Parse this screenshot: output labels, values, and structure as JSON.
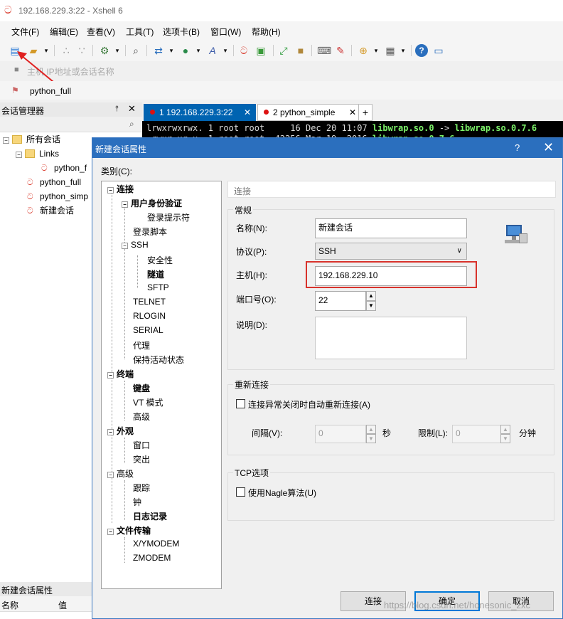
{
  "window": {
    "title": "192.168.229.3:22 - Xshell 6"
  },
  "menu": [
    "文件(F)",
    "编辑(E)",
    "查看(V)",
    "工具(T)",
    "选项卡(B)",
    "窗口(W)",
    "帮助(H)"
  ],
  "address": {
    "placeholder": "主机 IP地址或会话名称"
  },
  "quick_session": {
    "label": "python_full"
  },
  "session_manager": {
    "title": "会话管理器",
    "tree": {
      "root": "所有会话",
      "folder": "Links",
      "folder_child": "python_f",
      "items": [
        "python_full",
        "python_simp",
        "新建会话"
      ]
    }
  },
  "properties_panel": {
    "title": "新建会话属性",
    "col_name": "名称",
    "col_value": "值"
  },
  "tabs": [
    {
      "label": "1 192.168.229.3:22",
      "active": true
    },
    {
      "label": "2 python_simple",
      "active": false
    }
  ],
  "terminal": {
    "line1_prefix": "lrwxrwxrwx. 1 root root     16 Dec 20 11:07 ",
    "line1_link": "libwrap.so.0",
    "line1_arrow": " -> ",
    "line1_target": "libwrap.so.0.7.6",
    "line2_prefix": "-rwxr-xr-x. 1 root root  42256 Mar 19  2016 ",
    "line2_file": "libwrap.so.0.7.6"
  },
  "dialog": {
    "title": "新建会话属性",
    "help": "?",
    "category_label": "类别(C):",
    "categories": [
      "连接",
      "用户身份验证",
      "登录提示符",
      "登录脚本",
      "SSH",
      "安全性",
      "隧道",
      "SFTP",
      "TELNET",
      "RLOGIN",
      "SERIAL",
      "代理",
      "保持活动状态",
      "终端",
      "键盘",
      "VT 模式",
      "高级",
      "外观",
      "窗口",
      "突出",
      "高级",
      "跟踪",
      "钟",
      "日志记录",
      "文件传输",
      "X/YMODEM",
      "ZMODEM"
    ],
    "section_header": "连接",
    "general": {
      "title": "常规",
      "name_label": "名称(N):",
      "name_value": "新建会话",
      "protocol_label": "协议(P):",
      "protocol_value": "SSH",
      "host_label": "主机(H):",
      "host_value": "192.168.229.10",
      "port_label": "端口号(O):",
      "port_value": "22",
      "desc_label": "说明(D):",
      "desc_value": ""
    },
    "reconnect": {
      "title": "重新连接",
      "checkbox_label": "连接异常关闭时自动重新连接(A)",
      "interval_label": "间隔(V):",
      "interval_value": "0",
      "interval_unit": "秒",
      "limit_label": "限制(L):",
      "limit_value": "0",
      "limit_unit": "分钟"
    },
    "tcp": {
      "title": "TCP选项",
      "nagle_label": "使用Nagle算法(U)"
    },
    "buttons": {
      "connect": "连接",
      "ok": "确定",
      "cancel": "取消"
    }
  },
  "watermark": "https://blog.csdn.net/honesonic_zxc",
  "colors": {
    "accent": "#2b6fbe",
    "highlight": "#d8322b"
  }
}
